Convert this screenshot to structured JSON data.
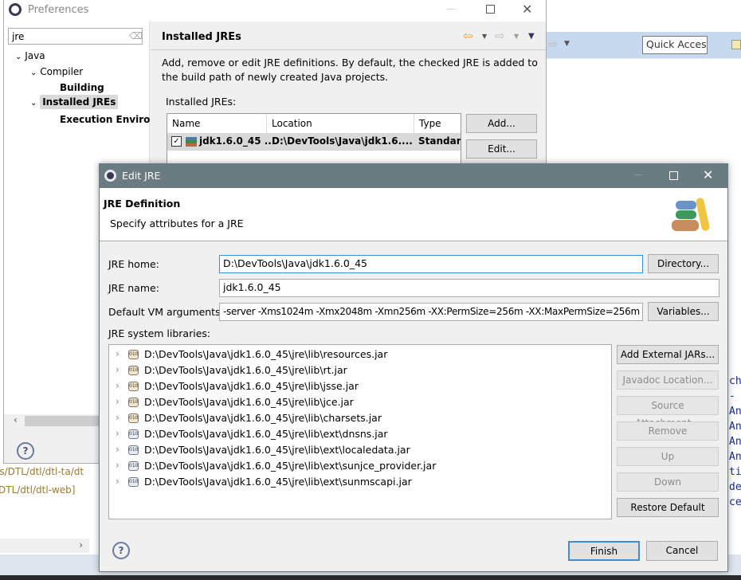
{
  "background": {
    "quick_access": "Quick Access",
    "left_fragments": [
      "es/DTL/dtl/dtl-ta/dt",
      "DTL/dtl/dtl-web]"
    ],
    "console_lines": [
      "ch",
      "-",
      "An",
      "An",
      "An",
      "An",
      "ti",
      "de",
      "ce"
    ]
  },
  "preferences": {
    "title": "Preferences",
    "filter_value": "jre",
    "tree": [
      {
        "label": "Java",
        "expanded": true,
        "bold": false
      },
      {
        "label": "Compiler",
        "expanded": true,
        "bold": false
      },
      {
        "label": "Building",
        "bold": true
      },
      {
        "label": "Installed JREs",
        "expanded": true,
        "bold": true,
        "selected": true
      },
      {
        "label": "Execution Enviro",
        "bold": true
      }
    ],
    "page_title": "Installed JREs",
    "description": "Add, remove or edit JRE definitions. By default, the checked JRE is added to the build path of newly created Java projects.",
    "table_label": "Installed JREs:",
    "columns": [
      "Name",
      "Location",
      "Type"
    ],
    "rows": [
      {
        "name": "jdk1.6.0_45 ...",
        "location": "D:\\DevTools\\Java\\jdk1.6....",
        "type": "Standard",
        "checked": true
      }
    ],
    "buttons": {
      "add": "Add...",
      "edit": "Edit..."
    },
    "help": "?"
  },
  "edit_jre": {
    "title": "Edit JRE",
    "header_title": "JRE Definition",
    "header_subtitle": "Specify attributes for a JRE",
    "jre_home_label": "JRE home:",
    "jre_home_value": "D:\\DevTools\\Java\\jdk1.6.0_45",
    "jre_name_label": "JRE name:",
    "jre_name_value": "jdk1.6.0_45",
    "vm_args_label": "Default VM arguments:",
    "vm_args_value": "-server -Xms1024m -Xmx2048m -Xmn256m -XX:PermSize=256m -XX:MaxPermSize=256m",
    "directory_button": "Directory...",
    "variables_button": "Variables...",
    "libraries_label": "JRE system libraries:",
    "libraries": [
      "D:\\DevTools\\Java\\jdk1.6.0_45\\jre\\lib\\resources.jar",
      "D:\\DevTools\\Java\\jdk1.6.0_45\\jre\\lib\\rt.jar",
      "D:\\DevTools\\Java\\jdk1.6.0_45\\jre\\lib\\jsse.jar",
      "D:\\DevTools\\Java\\jdk1.6.0_45\\jre\\lib\\jce.jar",
      "D:\\DevTools\\Java\\jdk1.6.0_45\\jre\\lib\\charsets.jar",
      "D:\\DevTools\\Java\\jdk1.6.0_45\\jre\\lib\\ext\\dnsns.jar",
      "D:\\DevTools\\Java\\jdk1.6.0_45\\jre\\lib\\ext\\localedata.jar",
      "D:\\DevTools\\Java\\jdk1.6.0_45\\jre\\lib\\ext\\sunjce_provider.jar",
      "D:\\DevTools\\Java\\jdk1.6.0_45\\jre\\lib\\ext\\sunmscapi.jar"
    ],
    "side_buttons": [
      {
        "label": "Add External JARs...",
        "enabled": true
      },
      {
        "label": "Javadoc Location...",
        "enabled": false
      },
      {
        "label": "Source Attachment...",
        "enabled": false
      },
      {
        "label": "Remove",
        "enabled": false
      },
      {
        "label": "Up",
        "enabled": false
      },
      {
        "label": "Down",
        "enabled": false
      },
      {
        "label": "Restore Default",
        "enabled": true
      }
    ],
    "finish": "Finish",
    "cancel": "Cancel",
    "help": "?",
    "titlebar_color": "#6b7b82"
  }
}
